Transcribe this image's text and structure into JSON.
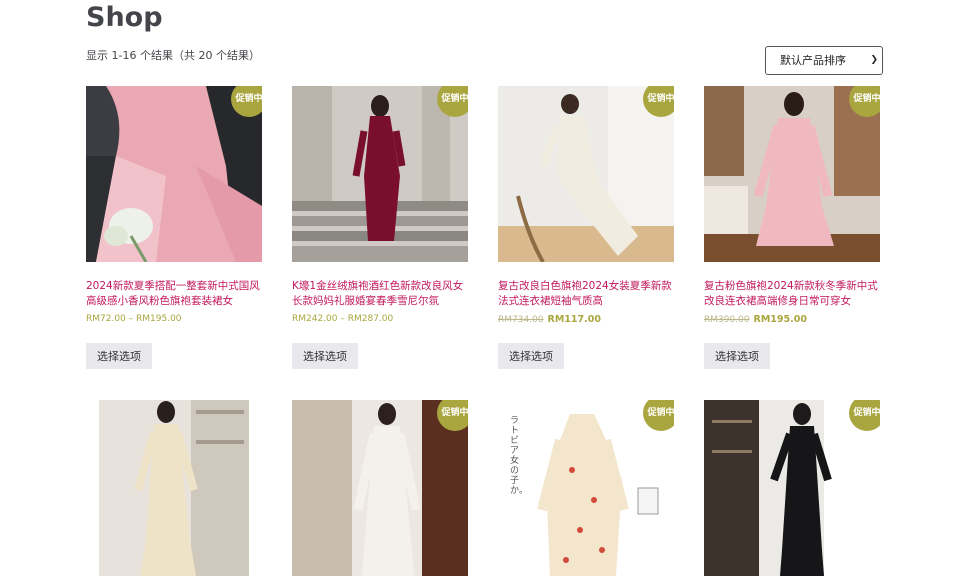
{
  "page": {
    "title": "Shop",
    "result_count": "显示 1-16 个结果（共 20 个结果）"
  },
  "sort": {
    "selected": "默认产品排序"
  },
  "colors": {
    "badge": "#a9a63f",
    "title": "#c2185b",
    "button_bg": "#e9e9ed"
  },
  "products": [
    {
      "title": "2024新款夏季搭配一整套新中式国风高级感小香风粉色旗袍套装裙女",
      "price": "RM72.00 – RM195.00",
      "old_price": "",
      "sale_price": "",
      "badge": "促销中",
      "button": "选择选项"
    },
    {
      "title": "K壕1金丝绒旗袍酒红色新款改良风女长款妈妈礼服婚宴春季雪尼尔氛",
      "price": "RM242.00 – RM287.00",
      "old_price": "",
      "sale_price": "",
      "badge": "促销中",
      "button": "选择选项"
    },
    {
      "title": "复古改良白色旗袍2024女装夏季新款法式连衣裙短袖气质高",
      "price": "",
      "old_price": "RM734.00",
      "sale_price": "RM117.00",
      "badge": "促销中",
      "button": "选择选项"
    },
    {
      "title": "复古粉色旗袍2024新款秋冬季新中式改良连衣裙高端修身日常可穿女",
      "price": "",
      "old_price": "RM390.00",
      "sale_price": "RM195.00",
      "badge": "促销中",
      "button": "选择选项"
    },
    {
      "title": "",
      "badge": ""
    },
    {
      "title": "",
      "badge": "促销中"
    },
    {
      "title": "",
      "badge": "促销中",
      "image_text": "ラトビア女の子か。"
    },
    {
      "title": "",
      "badge": "促销中"
    }
  ]
}
